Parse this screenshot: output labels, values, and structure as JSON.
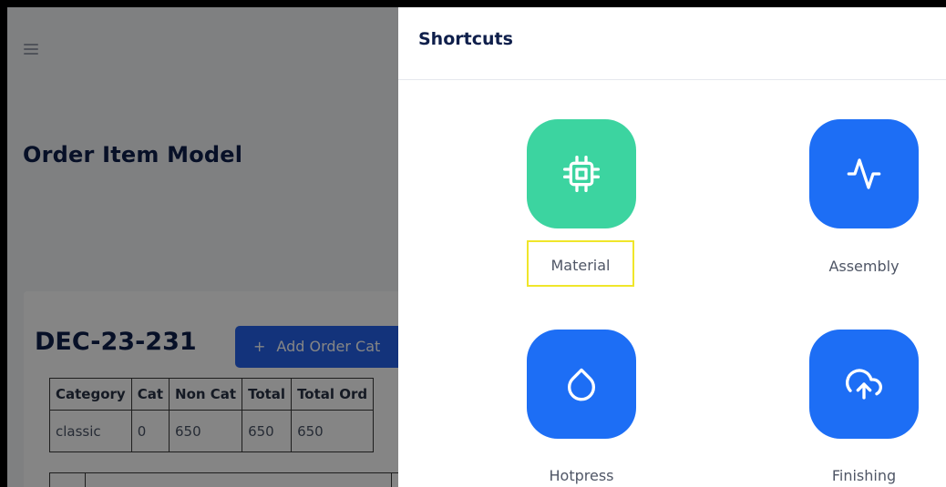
{
  "background": {
    "page_title": "Order Item Model",
    "order_id": "DEC-23-231",
    "add_button_label": "Add Order Cat",
    "table": {
      "headers": [
        "Category",
        "Cat",
        "Non Cat",
        "Total",
        "Total Ord"
      ],
      "rows": [
        [
          "classic",
          "0",
          "650",
          "650",
          "650"
        ]
      ]
    }
  },
  "drawer": {
    "title": "Shortcuts",
    "shortcuts": [
      {
        "label": "Material",
        "icon": "cpu-icon",
        "color": "#3cd4a0"
      },
      {
        "label": "Assembly",
        "icon": "activity-icon",
        "color": "#1d6ef5"
      },
      {
        "label": "Hotpress",
        "icon": "droplet-icon",
        "color": "#1d6ef5"
      },
      {
        "label": "Finishing",
        "icon": "cloud-upload-icon",
        "color": "#1d6ef5"
      }
    ]
  },
  "colors": {
    "primary": "#2563eb",
    "highlight": "#f0e62a",
    "title": "#0f1f4b"
  }
}
